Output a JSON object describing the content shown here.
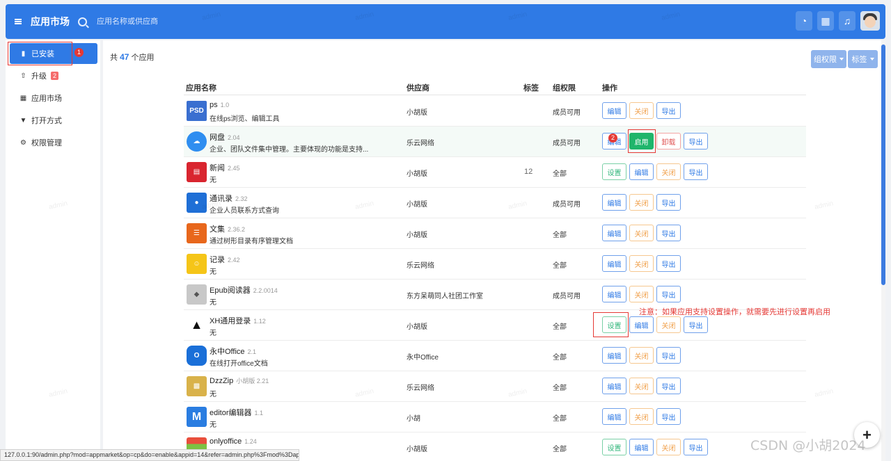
{
  "header": {
    "title": "应用市场",
    "search_placeholder": "应用名称或供应商",
    "icons": [
      "menu-icon",
      "palette-icon",
      "grid-icon",
      "bell-icon",
      "avatar"
    ]
  },
  "sidebar": {
    "items": [
      {
        "label": "已安装",
        "icon": "file-icon",
        "active": true,
        "marker": "1"
      },
      {
        "label": "升级",
        "icon": "upgrade-icon",
        "badge": "2"
      },
      {
        "label": "应用市场",
        "icon": "grid-icon"
      },
      {
        "label": "打开方式",
        "icon": "filter-icon"
      },
      {
        "label": "权限管理",
        "icon": "gear-icon"
      }
    ]
  },
  "main": {
    "count_prefix": "共",
    "count": "47",
    "count_suffix": "个应用",
    "filters": {
      "group": "组权限",
      "tag": "标签"
    },
    "columns": {
      "name": "应用名称",
      "vendor": "供应商",
      "tag": "标签",
      "perm": "组权限",
      "ops": "操作"
    },
    "rows": [
      {
        "name": "ps",
        "version": "1.0",
        "desc": "在线ps浏览、编辑工具",
        "vendor": "小胡版",
        "tag": "",
        "perm": "成员可用",
        "buttons": [
          "编辑",
          "关闭",
          "导出"
        ]
      },
      {
        "name": "网盘",
        "version": "2.04",
        "desc": "企业、团队文件集中管理。主要体现的功能是支持...",
        "vendor": "乐云网络",
        "tag": "",
        "perm": "成员可用",
        "buttons": [
          "编辑",
          "启用",
          "卸载",
          "导出"
        ],
        "marker": "2"
      },
      {
        "name": "新闻",
        "version": "2.45",
        "desc": "无",
        "vendor": "小胡版",
        "tag": "12",
        "perm": "全部",
        "buttons": [
          "设置",
          "编辑",
          "关闭",
          "导出"
        ]
      },
      {
        "name": "通讯录",
        "version": "2.32",
        "desc": "企业人员联系方式查询",
        "vendor": "小胡版",
        "tag": "",
        "perm": "成员可用",
        "buttons": [
          "编辑",
          "关闭",
          "导出"
        ]
      },
      {
        "name": "文集",
        "version": "2.36.2",
        "desc": "通过树形目录有序管理文档",
        "vendor": "小胡版",
        "tag": "",
        "perm": "全部",
        "buttons": [
          "编辑",
          "关闭",
          "导出"
        ]
      },
      {
        "name": "记录",
        "version": "2.42",
        "desc": "无",
        "vendor": "乐云网络",
        "tag": "",
        "perm": "全部",
        "buttons": [
          "编辑",
          "关闭",
          "导出"
        ]
      },
      {
        "name": "Epub阅读器",
        "version": "2.2.0014",
        "desc": "无",
        "vendor": "东方呆萌同人社团工作室",
        "tag": "",
        "perm": "成员可用",
        "buttons": [
          "编辑",
          "关闭",
          "导出"
        ]
      },
      {
        "name": "XH通用登录",
        "version": "1.12",
        "desc": "无",
        "vendor": "小胡版",
        "tag": "",
        "perm": "全部",
        "buttons": [
          "设置",
          "编辑",
          "关闭",
          "导出"
        ]
      },
      {
        "name": "永中Office",
        "version": "2.1",
        "desc": "在线打开office文档",
        "vendor": "永中Office",
        "tag": "",
        "perm": "全部",
        "buttons": [
          "编辑",
          "关闭",
          "导出"
        ]
      },
      {
        "name": "DzzZip",
        "version": "小胡版 2.21",
        "desc": "无",
        "vendor": "乐云网络",
        "tag": "",
        "perm": "全部",
        "buttons": [
          "编辑",
          "关闭",
          "导出"
        ]
      },
      {
        "name": "editor编辑器",
        "version": "1.1",
        "desc": "无",
        "vendor": "小胡",
        "tag": "",
        "perm": "全部",
        "buttons": [
          "编辑",
          "关闭",
          "导出"
        ]
      },
      {
        "name": "onlyoffice",
        "version": "1.24",
        "desc": "",
        "vendor": "小胡版",
        "tag": "",
        "perm": "全部",
        "buttons": [
          "设置",
          "编辑",
          "关闭",
          "导出"
        ]
      }
    ],
    "note": "注意：如果应用支持设置操作，就需要先进行设置再启用"
  },
  "status_url": "127.0.0.1:90/admin.php?mod=appmarket&op=cp&do=enable&appid=14&refer=admin.php%3Fmod%3Dappmar...",
  "watermark": "admin",
  "csdn_mark": "CSDN @小胡2024",
  "colors": {
    "primary": "#2f7ae5",
    "success": "#1fb56b",
    "warning": "#f0a04b",
    "danger": "#e53935"
  }
}
